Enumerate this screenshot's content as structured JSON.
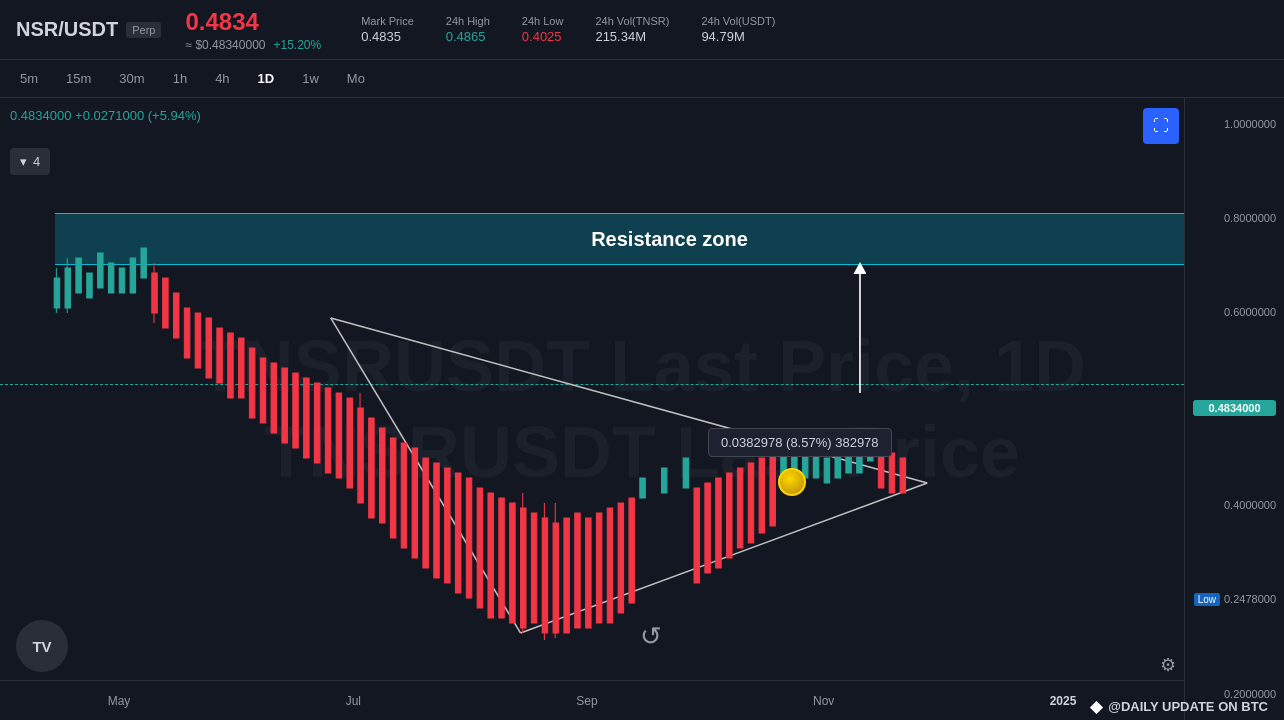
{
  "header": {
    "symbol": "NSR/USDT",
    "perp": "Perp",
    "main_price": "0.4834",
    "usd_equiv": "≈ $0.48340000",
    "change": "+15.20%",
    "stats": [
      {
        "label": "Mark Price",
        "value": "0.4835",
        "style": "normal"
      },
      {
        "label": "24h High",
        "value": "0.4865",
        "style": "up"
      },
      {
        "label": "24h Low",
        "value": "0.4025",
        "style": "down"
      },
      {
        "label": "24h Vol(TNSR)",
        "value": "215.34M",
        "style": "normal"
      },
      {
        "label": "24h Vol(USDT)",
        "value": "94.79M",
        "style": "normal"
      }
    ]
  },
  "timeframes": [
    {
      "label": "5m",
      "active": false
    },
    {
      "label": "15m",
      "active": false
    },
    {
      "label": "30m",
      "active": false
    },
    {
      "label": "1h",
      "active": false
    },
    {
      "label": "4h",
      "active": false
    },
    {
      "label": "1D",
      "active": true
    },
    {
      "label": "1w",
      "active": false
    },
    {
      "label": "Mo",
      "active": false
    }
  ],
  "chart": {
    "ohlc": "0.4834000  +0.0271000 (+5.94%)",
    "watermark_line1": "TNSRUSDT Last Price, 1D",
    "watermark_line2": "TNSRUSDT Last Price",
    "resistance_label": "Resistance zone",
    "tooltip": "0.0382978 (8.57%) 382978",
    "current_price": "0.4834000",
    "low_badge": "Low",
    "low_price": "0.2478000",
    "price_ticks": [
      "1.0000000",
      "0.8000000",
      "0.6000000",
      "0.4834000",
      "0.4000000",
      "0.2478000",
      "0.2000000"
    ]
  },
  "time_axis": {
    "labels": [
      "May",
      "Jul",
      "Sep",
      "Nov",
      "2025"
    ]
  },
  "dropdown_label": "4",
  "social": {
    "handle": "@DAILY UPDATE ON BTC"
  },
  "icons": {
    "dropdown_arrow": "▾",
    "refresh": "↺",
    "gear": "⚙",
    "diamond": "◆",
    "expand": "⛶"
  }
}
